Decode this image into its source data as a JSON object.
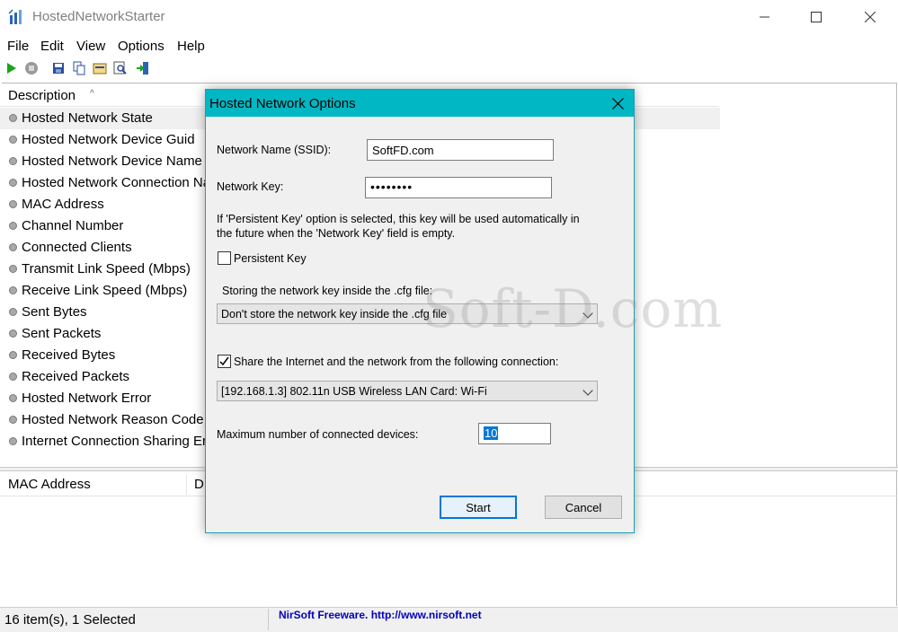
{
  "app": {
    "title": "HostedNetworkStarter"
  },
  "menu": [
    "File",
    "Edit",
    "View",
    "Options",
    "Help"
  ],
  "toolbar": {
    "icons": [
      "start-icon",
      "stop-icon",
      "save-icon",
      "copy-icon",
      "properties-icon",
      "find-icon",
      "exit-icon"
    ]
  },
  "list": {
    "column_header": "Description",
    "rows": [
      "Hosted Network State",
      "Hosted Network Device Guid",
      "Hosted Network Device Name",
      "Hosted Network Connection Na",
      "MAC Address",
      "Channel Number",
      "Connected Clients",
      "Transmit Link Speed (Mbps)",
      "Receive Link Speed (Mbps)",
      "Sent Bytes",
      "Sent Packets",
      "Received Bytes",
      "Received Packets",
      "Hosted Network Error",
      "Hosted Network Reason Code",
      "Internet Connection Sharing Err"
    ],
    "selected_index": 0
  },
  "lower_list": {
    "col1": "MAC Address",
    "col2": "D"
  },
  "status": {
    "count": "16 item(s), 1 Selected",
    "link": "NirSoft Freeware.  http://www.nirsoft.net"
  },
  "dialog": {
    "title": "Hosted Network Options",
    "ssid_label": "Network Name (SSID):",
    "ssid_value": "SoftFD.com",
    "key_label": "Network Key:",
    "key_value": "••••••••",
    "note_line1": "If 'Persistent Key' option is selected, this key will be used automatically in",
    "note_line2": "the future when the 'Network Key' field is empty.",
    "persistent_label": "Persistent Key",
    "persistent_checked": false,
    "store_label": "Storing the network key inside the .cfg file:",
    "store_value": "Don't store the network key inside the .cfg file",
    "share_label": "Share the Internet and the network from the following connection:",
    "share_checked": true,
    "connection_value": "[192.168.1.3]  802.11n USB Wireless LAN Card: Wi-Fi",
    "max_label": "Maximum number of connected devices:",
    "max_value": "10",
    "start_label": "Start",
    "cancel_label": "Cancel"
  },
  "watermark": "Soft-D.com",
  "colors": {
    "dialog_title_bg": "#00b7c3",
    "link": "#0000c0",
    "selection": "#0078d7"
  }
}
